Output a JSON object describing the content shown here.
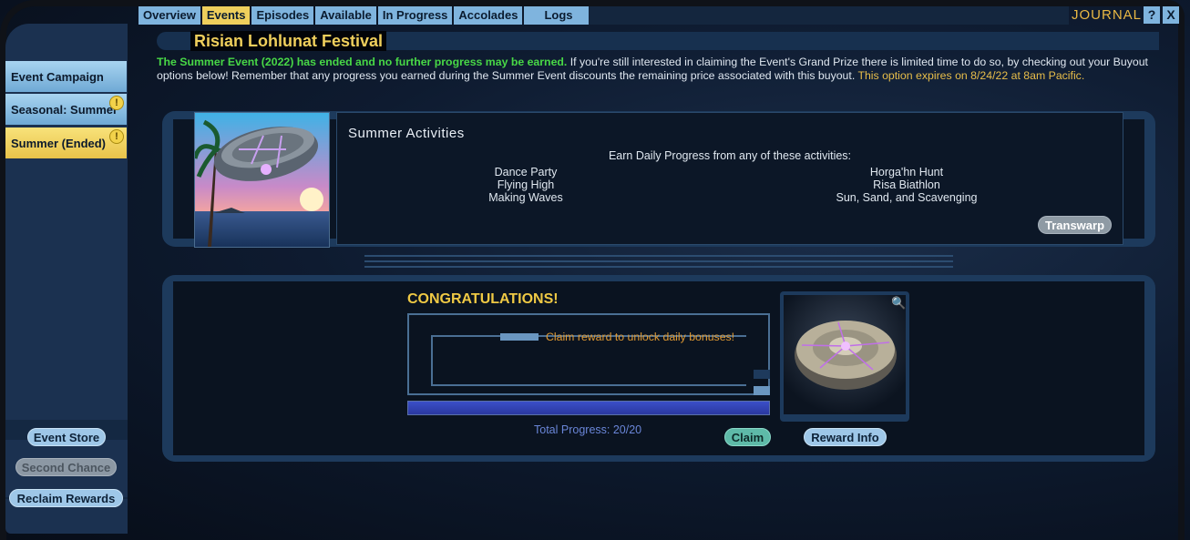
{
  "tabs": [
    {
      "label": "Overview",
      "active": false
    },
    {
      "label": "Events",
      "active": true
    },
    {
      "label": "Episodes",
      "active": false
    },
    {
      "label": "Available",
      "active": false
    },
    {
      "label": "In Progress",
      "active": false
    },
    {
      "label": "Accolades",
      "active": false
    },
    {
      "label": "Logs",
      "active": false
    }
  ],
  "header": {
    "journal": "JOURNAL",
    "help": "?",
    "close": "X"
  },
  "sidebar": {
    "items": [
      {
        "label": "Event Campaign"
      },
      {
        "label": "Seasonal: Summer"
      },
      {
        "label": "Summer (Ended)"
      }
    ],
    "alert_glyph": "!",
    "buttons": {
      "event_store": "Event Store",
      "second_chance": "Second Chance",
      "reclaim_rewards": "Reclaim Rewards"
    }
  },
  "event": {
    "title": "Risian Lohlunat Festival",
    "notice_green": "The Summer Event (2022) has ended and no further progress may be earned.",
    "notice_body": " If you're still interested in claiming the Event's Grand Prize there is limited time to do so, by checking out your Buyout options below! Remember that any progress you earned during the Summer Event discounts the remaining price associated with this buyout. ",
    "notice_yellow": "This option expires on 8/24/22 at 8am Pacific."
  },
  "activities": {
    "title": "Summer Activities",
    "subtitle": "Earn Daily Progress from any of these activities:",
    "left": [
      "Dance Party",
      "Flying High",
      "Making Waves"
    ],
    "right": [
      "Horga'hn Hunt",
      "Risa Biathlon",
      "Sun, Sand, and Scavenging"
    ],
    "transwarp": "Transwarp"
  },
  "progress": {
    "congrats": "CONGRATULATIONS!",
    "claim_message": "Claim reward to unlock daily bonuses!",
    "total": "Total Progress: 20/20",
    "fraction": 1.0,
    "claim": "Claim",
    "reward_info": "Reward Info"
  },
  "colors": {
    "accent_yellow": "#efcf5c",
    "panel_blue": "#1d3a5c",
    "notice_green": "#48d846",
    "claim_orange": "#e19a32"
  }
}
